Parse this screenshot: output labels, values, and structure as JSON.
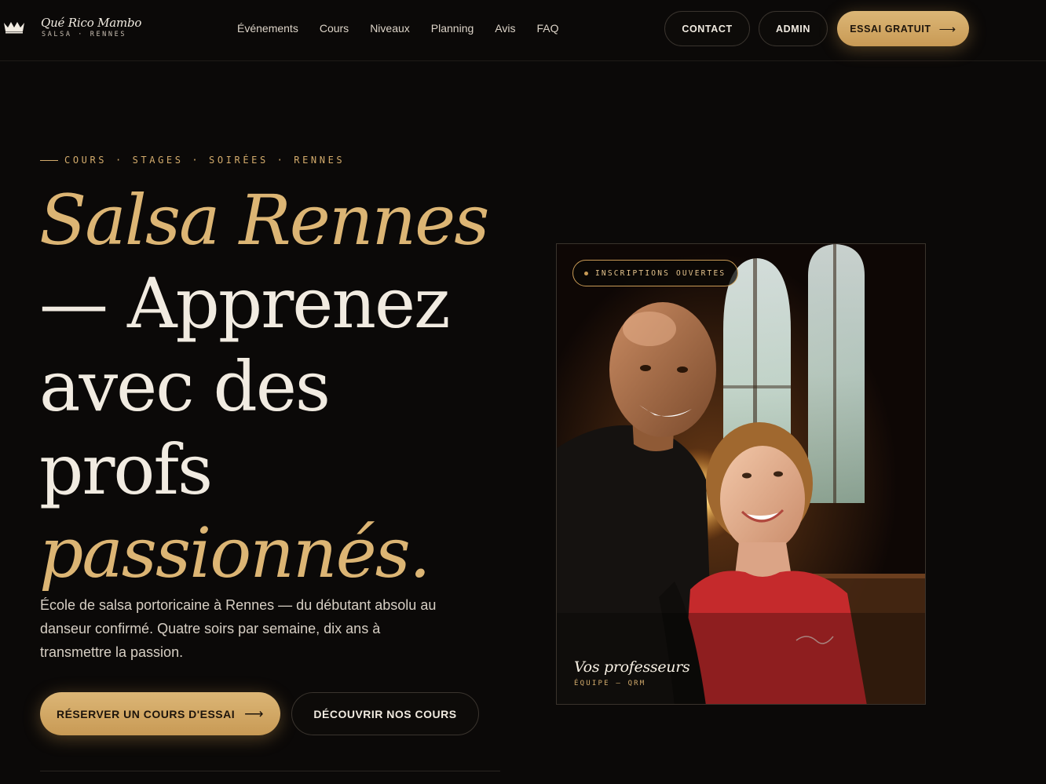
{
  "brand": {
    "name": "Qué Rico Mambo",
    "tagline": "SALSA · RENNES"
  },
  "nav": {
    "items": [
      "Événements",
      "Cours",
      "Niveaux",
      "Planning",
      "Avis",
      "FAQ"
    ]
  },
  "header_actions": {
    "contact": "CONTACT",
    "admin": "ADMIN",
    "trial": "ESSAI GRATUIT"
  },
  "hero": {
    "eyebrow": "COURS · STAGES · SOIRÉES · RENNES",
    "headline": {
      "line1": "Salsa Rennes",
      "line2": "— Apprenez",
      "line3": "avec des",
      "line4": "profs",
      "line5": "passionnés."
    },
    "intro": "École de salsa portoricaine à Rennes — du débutant absolu au danseur confirmé. Quatre soirs par semaine, dix ans à transmettre la passion.",
    "cta_primary": "RÉSERVER UN COURS D'ESSAI",
    "cta_secondary": "DÉCOUVRIR NOS COURS"
  },
  "photo_card": {
    "badge": "INSCRIPTIONS OUVERTES",
    "caption": "Vos professeurs",
    "sub": "ÉQUIPE — QRM"
  },
  "colors": {
    "background": "#0b0908",
    "gold": "#dcb574",
    "cream": "#f1ebe1",
    "border": "#3a342e"
  },
  "icons": {
    "arrow": "arrow-right-icon",
    "logo": "crown-logo-icon",
    "badge_dot": "status-dot-icon"
  }
}
